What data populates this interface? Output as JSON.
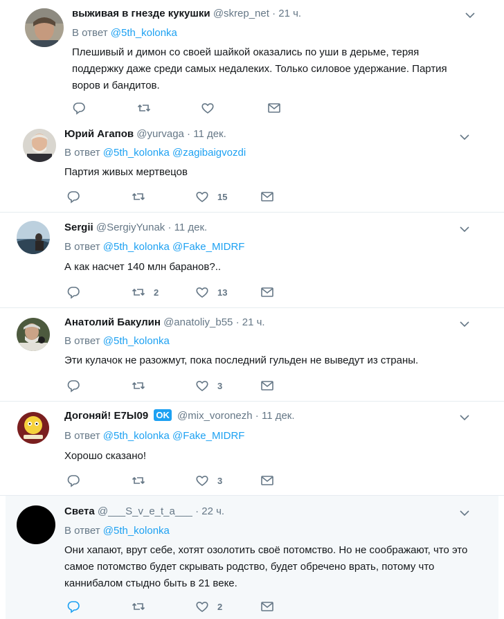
{
  "reply_prefix": "В ответ",
  "tweets": [
    {
      "name": "выживая в гнезде кукушки",
      "handle": "@skrep_net",
      "time": "21 ч.",
      "mentions": [
        "@5th_kolonka"
      ],
      "text": "Плешивый и димон со своей шайкой оказались по уши в дерьме, теряя поддержку даже   среди самых недалеких. Только силовое удержание. Партия воров и бандитов.",
      "likes": ""
    },
    {
      "name": "Юрий Агапов",
      "handle": "@yurvaga",
      "time": "11 дек.",
      "mentions": [
        "@5th_kolonka",
        "@zagibaigvozdi"
      ],
      "text": "Партия живых мертвецов",
      "likes": "15"
    },
    {
      "name": "Sergii",
      "handle": "@SergiyYunak",
      "time": "11 дек.",
      "mentions": [
        "@5th_kolonka",
        "@Fake_MIDRF"
      ],
      "text": "А как насчет 140 млн баранов?..",
      "retweets": "2",
      "likes": "13"
    },
    {
      "name": "Анатолий Бакулин",
      "handle": "@anatoliy_b55",
      "time": "21 ч.",
      "mentions": [
        "@5th_kolonka"
      ],
      "text": "Эти кулачок не разожмут, пока последний гульден не выведут из страны.",
      "likes": "3"
    },
    {
      "name": "Догоняй! E7Ы09",
      "badge": "OK",
      "handle": "@mix_voronezh",
      "time": "11 дек.",
      "mentions": [
        "@5th_kolonka",
        "@Fake_MIDRF"
      ],
      "text": "Хорошо сказано!",
      "likes": "3"
    },
    {
      "name": "Света",
      "handle": "@___S_v_e_t_a___",
      "time": "22 ч.",
      "mentions": [
        "@5th_kolonka"
      ],
      "text": "Они хапают, врут себе, хотят озолотить своё потомство. Но не соображают, что это самое потомство будет скрывать родство, будет обречено врать, потому что каннибалом стыдно быть в 21 веке.",
      "likes": "2"
    }
  ],
  "colors": {
    "link": "#1da1f2",
    "secondary": "#657786",
    "text": "#14171a",
    "divider": "#e6ecf0",
    "highlight_bg": "#f5f8fa"
  },
  "icons": [
    "reply-icon",
    "retweet-icon",
    "like-icon",
    "message-icon",
    "chevron-down-icon"
  ]
}
